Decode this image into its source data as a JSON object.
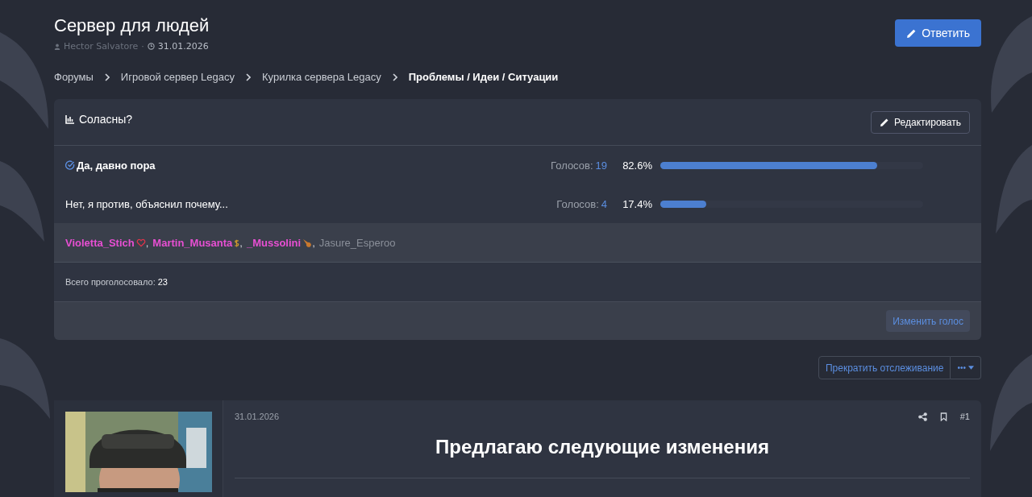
{
  "thread": {
    "title": "Сервер для людей",
    "author": "Hector Salvatore",
    "separator": "·",
    "date": "31.01.2026"
  },
  "reply_button": "Ответить",
  "breadcrumbs": [
    {
      "label": "Форумы",
      "current": false
    },
    {
      "label": "Игровой сервер Legacy",
      "current": false
    },
    {
      "label": "Курилка сервера Legacy",
      "current": false
    },
    {
      "label": "Проблемы / Идеи / Ситуации",
      "current": true
    }
  ],
  "poll": {
    "title": "Соласны?",
    "edit_button": "Редактировать",
    "options": [
      {
        "label": "Да, давно пора",
        "selected": true,
        "votes_label": "Голосов:",
        "votes": "19",
        "percent": "82.6%",
        "level": 0.826
      },
      {
        "label": "Нет, я против, объяснил почему...",
        "selected": false,
        "votes_label": "Голосов:",
        "votes": "4",
        "percent": "17.4%",
        "level": 0.174
      }
    ],
    "voters": [
      {
        "name": "Violetta_Stich",
        "color": "#e84fd3",
        "kind": "heart",
        "separator": ","
      },
      {
        "name": "Martin_Musanta",
        "color": "#e84fd3",
        "kind": "dollar",
        "separator": ","
      },
      {
        "name": "_Mussolini",
        "color": "#e84fd3",
        "kind": "comet",
        "separator": ","
      },
      {
        "name": "Jasure_Esperoo",
        "color": "#8a8f99",
        "kind": "plain"
      }
    ],
    "total_label": "Всего проголосовало:",
    "total": "23",
    "change_vote_button": "Изменить голос"
  },
  "unwatch_button": "Прекратить отслеживание",
  "more_button": "•••",
  "post": {
    "date": "31.01.2026",
    "number": "#1",
    "heading": "Предлагаю следующие изменения"
  }
}
